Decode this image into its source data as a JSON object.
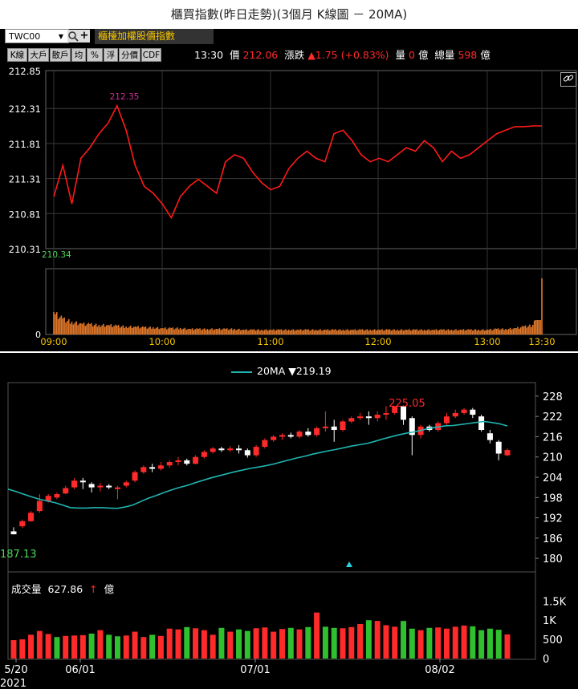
{
  "page_title": "櫃買指數(昨日走勢)(3個月 K線圖 － 20MA)",
  "toolbar": {
    "symbol": "TWC00",
    "index_name": "櫃檯加權股價指數",
    "buttons": [
      "K線",
      "大戶",
      "散戶",
      "均",
      "%",
      "浮",
      "分價",
      "CDF"
    ]
  },
  "quote": {
    "time": "13:30",
    "price_label": "價",
    "price": "212.06",
    "change_label": "漲跌",
    "change": "▲1.75 (+0.83%)",
    "volume_label": "量",
    "volume": "0",
    "unit1": "億",
    "total_volume_label": "總量",
    "total_volume": "598",
    "unit2": "億"
  },
  "colors": {
    "up": "#ff2a2a",
    "down": "#2fbf2f",
    "ma": "#1fb5b0",
    "intraday_line": "#ff1a1a",
    "intraday_volume": "#e0782a"
  },
  "chart_data": [
    {
      "type": "line",
      "title": "",
      "ylim": [
        210.31,
        212.85
      ],
      "y_ticks": [
        "212.85",
        "212.31",
        "211.81",
        "211.31",
        "210.81",
        "210.31"
      ],
      "x_ticks": [
        "09:00",
        "10:00",
        "11:00",
        "12:00",
        "13:00",
        "13:30"
      ],
      "annotations": {
        "high": "212.35",
        "low": "210.34"
      },
      "volume_axis_label": "0",
      "x": [
        "09:00",
        "09:05",
        "09:10",
        "09:15",
        "09:20",
        "09:25",
        "09:30",
        "09:35",
        "09:40",
        "09:45",
        "09:50",
        "09:55",
        "10:00",
        "10:05",
        "10:10",
        "10:15",
        "10:20",
        "10:25",
        "10:30",
        "10:35",
        "10:40",
        "10:45",
        "10:50",
        "10:55",
        "11:00",
        "11:05",
        "11:10",
        "11:15",
        "11:20",
        "11:25",
        "11:30",
        "11:35",
        "11:40",
        "11:45",
        "11:50",
        "11:55",
        "12:00",
        "12:05",
        "12:10",
        "12:15",
        "12:20",
        "12:25",
        "12:30",
        "12:35",
        "12:40",
        "12:45",
        "12:50",
        "12:55",
        "13:00",
        "13:05",
        "13:10",
        "13:15",
        "13:20",
        "13:25",
        "13:30"
      ],
      "values": [
        211.05,
        211.5,
        210.95,
        211.6,
        211.75,
        211.95,
        212.1,
        212.35,
        212.0,
        211.5,
        211.2,
        211.1,
        210.95,
        210.75,
        211.05,
        211.2,
        211.3,
        211.2,
        211.1,
        211.55,
        211.65,
        211.6,
        211.4,
        211.25,
        211.15,
        211.2,
        211.45,
        211.6,
        211.7,
        211.6,
        211.55,
        211.95,
        212.0,
        211.85,
        211.65,
        211.55,
        211.6,
        211.55,
        211.65,
        211.75,
        211.7,
        211.85,
        211.75,
        211.55,
        211.7,
        211.6,
        211.65,
        211.75,
        211.85,
        211.95,
        212.0,
        212.05,
        212.05,
        212.06,
        212.06
      ],
      "volume": [
        28,
        20,
        16,
        14,
        13,
        12,
        12,
        11,
        10,
        10,
        9,
        9,
        8,
        8,
        8,
        7,
        7,
        7,
        7,
        7,
        7,
        6,
        6,
        6,
        6,
        6,
        6,
        6,
        6,
        6,
        6,
        6,
        6,
        6,
        6,
        6,
        6,
        6,
        6,
        6,
        6,
        6,
        6,
        6,
        6,
        6,
        6,
        6,
        6,
        7,
        7,
        8,
        10,
        12,
        70
      ]
    },
    {
      "type": "candlestick",
      "title": "",
      "series_name": "20MA",
      "ma_label": "▼219.19",
      "ylim": [
        176,
        232
      ],
      "y_ticks": [
        "228",
        "222",
        "216",
        "210",
        "204",
        "198",
        "192",
        "186",
        "180"
      ],
      "x_ticks": [
        "5/20",
        "06/01",
        "07/01",
        "08/02"
      ],
      "year_label": "2021",
      "annotations": {
        "high": "225.05",
        "low": "187.13"
      },
      "volume_title": "成交量",
      "volume_value": "627.86",
      "volume_arrow": "↑",
      "volume_unit": "億",
      "volume_ticks": [
        "1.5K",
        "1K",
        "500",
        "0"
      ],
      "volume_ylim": [
        0,
        1800
      ],
      "candles": [
        [
          188.0,
          187.13,
          189.2,
          187.1
        ],
        [
          189.5,
          191.0,
          191.5,
          189.0
        ],
        [
          191.0,
          193.5,
          194.0,
          190.8
        ],
        [
          194.0,
          197.0,
          199.0,
          193.5
        ],
        [
          197.0,
          198.5,
          199.0,
          196.5
        ],
        [
          198.0,
          199.0,
          199.5,
          197.5
        ],
        [
          199.2,
          200.8,
          201.5,
          199.0
        ],
        [
          201.0,
          203.0,
          203.8,
          200.5
        ],
        [
          203.0,
          202.5,
          203.8,
          200.5
        ],
        [
          202.0,
          201.0,
          202.5,
          199.5
        ],
        [
          201.0,
          201.5,
          202.3,
          199.8
        ],
        [
          201.5,
          201.0,
          202.0,
          200.5
        ],
        [
          200.5,
          201.0,
          201.5,
          197.5
        ],
        [
          201.5,
          202.5,
          203.0,
          201.0
        ],
        [
          203.0,
          205.5,
          206.0,
          202.5
        ],
        [
          205.5,
          207.0,
          207.5,
          205.0
        ],
        [
          207.0,
          206.5,
          208.0,
          205.5
        ],
        [
          206.5,
          207.5,
          208.5,
          206.0
        ],
        [
          207.5,
          208.5,
          209.0,
          206.8
        ],
        [
          208.5,
          209.0,
          210.0,
          207.5
        ],
        [
          209.0,
          208.0,
          209.5,
          207.5
        ],
        [
          208.0,
          210.0,
          210.5,
          207.8
        ],
        [
          210.0,
          211.5,
          212.0,
          209.5
        ],
        [
          211.5,
          212.5,
          213.0,
          211.0
        ],
        [
          212.5,
          212.0,
          213.0,
          211.5
        ],
        [
          212.0,
          212.5,
          213.2,
          211.5
        ],
        [
          212.5,
          212.0,
          213.5,
          211.0
        ],
        [
          212.0,
          210.5,
          212.5,
          209.8
        ],
        [
          210.5,
          213.0,
          213.5,
          210.0
        ],
        [
          213.0,
          215.0,
          215.5,
          212.5
        ],
        [
          215.0,
          216.0,
          216.5,
          214.5
        ],
        [
          216.0,
          216.5,
          217.0,
          215.0
        ],
        [
          216.5,
          216.0,
          217.2,
          215.5
        ],
        [
          216.0,
          217.5,
          218.0,
          215.5
        ],
        [
          217.5,
          216.5,
          218.5,
          216.0
        ],
        [
          216.5,
          218.5,
          219.0,
          216.0
        ],
        [
          218.5,
          219.0,
          223.5,
          217.5
        ],
        [
          219.0,
          218.0,
          221.0,
          214.5
        ],
        [
          218.0,
          220.5,
          221.0,
          217.5
        ],
        [
          220.5,
          221.5,
          222.0,
          220.0
        ],
        [
          221.5,
          222.0,
          223.0,
          221.0
        ],
        [
          222.0,
          221.5,
          223.5,
          219.5
        ],
        [
          221.5,
          222.5,
          223.5,
          220.5
        ],
        [
          222.5,
          223.0,
          225.05,
          221.0
        ],
        [
          223.0,
          225.0,
          225.05,
          222.5
        ],
        [
          225.0,
          221.0,
          225.05,
          219.5
        ],
        [
          221.5,
          216.5,
          222.0,
          210.5
        ],
        [
          216.5,
          219.0,
          219.5,
          215.5
        ],
        [
          219.0,
          218.0,
          219.5,
          217.5
        ],
        [
          218.0,
          220.0,
          220.5,
          217.5
        ],
        [
          220.0,
          222.0,
          223.0,
          219.5
        ],
        [
          222.0,
          223.0,
          224.0,
          221.5
        ],
        [
          223.0,
          224.0,
          224.5,
          222.5
        ],
        [
          224.0,
          222.5,
          224.5,
          221.5
        ],
        [
          222.0,
          218.0,
          222.5,
          217.5
        ],
        [
          217.0,
          215.0,
          218.0,
          214.0
        ],
        [
          214.5,
          211.0,
          215.0,
          209.0
        ],
        [
          210.5,
          212.06,
          212.5,
          210.2
        ]
      ],
      "ma20": [
        200.5,
        199.8,
        199.0,
        198.2,
        197.5,
        197.0,
        196.5,
        195.8,
        195.0,
        194.9,
        194.9,
        195.0,
        195.0,
        194.9,
        194.8,
        195.2,
        195.8,
        196.8,
        197.8,
        198.6,
        199.5,
        200.3,
        201.0,
        201.6,
        202.4,
        203.1,
        203.8,
        204.4,
        205.0,
        205.6,
        206.1,
        206.6,
        207.0,
        207.4,
        207.9,
        208.5,
        209.1,
        209.7,
        210.2,
        210.8,
        211.3,
        211.8,
        212.2,
        212.7,
        213.2,
        213.6,
        214.0,
        214.6,
        215.3,
        215.9,
        216.5,
        217.0,
        217.4,
        217.9,
        218.5,
        218.8,
        219.2,
        219.3,
        219.6,
        219.9,
        220.2,
        220.5,
        220.2,
        219.8,
        219.19
      ],
      "volumes": [
        480,
        500,
        620,
        720,
        640,
        560,
        590,
        600,
        610,
        650,
        740,
        620,
        580,
        600,
        700,
        560,
        620,
        590,
        780,
        760,
        820,
        790,
        740,
        620,
        800,
        700,
        760,
        720,
        790,
        810,
        700,
        770,
        800,
        760,
        820,
        1200,
        830,
        800,
        790,
        820,
        900,
        1000,
        980,
        870,
        830,
        980,
        780,
        740,
        800,
        810,
        780,
        830,
        860,
        840,
        740,
        780,
        750,
        627.86
      ],
      "volume_up": [
        true,
        true,
        true,
        true,
        true,
        false,
        true,
        true,
        true,
        false,
        true,
        false,
        false,
        true,
        true,
        true,
        false,
        true,
        true,
        true,
        false,
        true,
        true,
        true,
        false,
        true,
        false,
        false,
        true,
        true,
        true,
        true,
        false,
        true,
        false,
        true,
        false,
        false,
        true,
        true,
        true,
        false,
        true,
        true,
        true,
        false,
        false,
        true,
        false,
        true,
        true,
        true,
        true,
        false,
        false,
        false,
        false,
        true
      ]
    }
  ]
}
